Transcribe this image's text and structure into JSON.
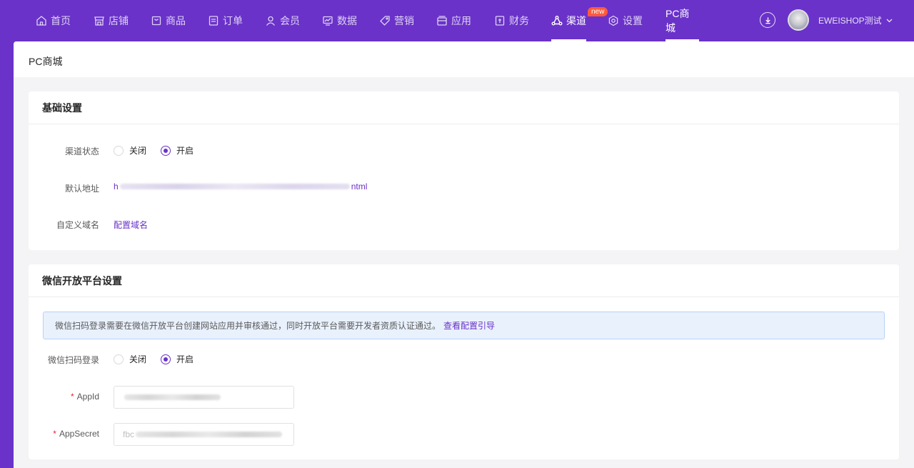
{
  "nav": {
    "items": [
      {
        "label": "首页",
        "icon": "home-icon"
      },
      {
        "label": "店铺",
        "icon": "shop-icon"
      },
      {
        "label": "商品",
        "icon": "goods-icon"
      },
      {
        "label": "订单",
        "icon": "order-icon"
      },
      {
        "label": "会员",
        "icon": "member-icon"
      },
      {
        "label": "数据",
        "icon": "data-icon"
      },
      {
        "label": "营销",
        "icon": "marketing-icon"
      },
      {
        "label": "应用",
        "icon": "app-icon"
      },
      {
        "label": "财务",
        "icon": "finance-icon"
      },
      {
        "label": "渠道",
        "icon": "channel-icon",
        "badge": "new"
      },
      {
        "label": "设置",
        "icon": "gear-icon"
      },
      {
        "label": "PC商城"
      }
    ],
    "user_name": "EWEISHOP测试",
    "download_icon": "download-icon",
    "colors": {
      "brand": "#6a32c9",
      "badge": "#ff5a3c"
    }
  },
  "page": {
    "title": "PC商城"
  },
  "basic": {
    "heading": "基础设置",
    "channel_status_label": "渠道状态",
    "option_off": "关闭",
    "option_on": "开启",
    "selected": "开启",
    "default_url_label": "默认地址",
    "default_url_prefix": "h",
    "default_url_suffix": "ntml",
    "custom_domain_label": "自定义域名",
    "custom_domain_link": "配置域名"
  },
  "wechat": {
    "heading": "微信开放平台设置",
    "notice": "微信扫码登录需要在微信开放平台创建网站应用并审核通过，同时开放平台需要开发者资质认证通过。",
    "notice_link": "查看配置引导",
    "scan_login_label": "微信扫码登录",
    "option_off": "关闭",
    "option_on": "开启",
    "selected": "开启",
    "appid_label": "AppId",
    "appsecret_label": "AppSecret",
    "appsecret_prefix": "fbc"
  }
}
